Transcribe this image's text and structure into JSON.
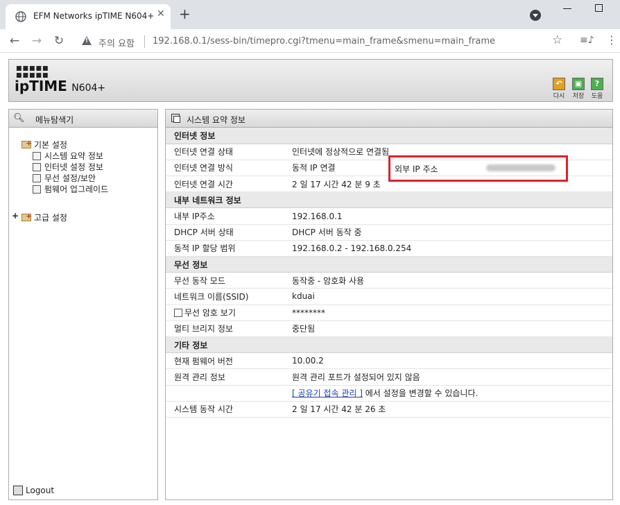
{
  "browser": {
    "tab_title": "EFM Networks ipTIME N604+",
    "tab_close": "✕",
    "new_tab": "+",
    "address_warning": "주의 요함",
    "url": "192.168.0.1/sess-bin/timepro.cgi?tmenu=main_frame&smenu=main_frame",
    "icons": [
      "globe-icon",
      "back-icon",
      "forward-icon",
      "reload-icon",
      "warning-icon",
      "star-icon",
      "media-control-icon",
      "more-menu-icon",
      "minimize-icon",
      "maximize-icon"
    ]
  },
  "router": {
    "brand": "ipTIME",
    "model": "N604+",
    "header_buttons": [
      {
        "label": "다시",
        "color": "#e0a020",
        "icon": "undo-icon"
      },
      {
        "label": "저장",
        "color": "#4caf50",
        "icon": "save-icon"
      },
      {
        "label": "도움",
        "color": "#4caf50",
        "icon": "help-icon"
      }
    ],
    "sidebar": {
      "title": "메뉴탐색기",
      "basic_folder": "기본 설정",
      "basic_items": [
        "시스템 요약 정보",
        "인터넷 설정 정보",
        "무선 설정/보안",
        "펌웨어 업그레이드"
      ],
      "advanced_folder": "고급 설정",
      "expand_symbol": "+",
      "logout": "Logout"
    },
    "content": {
      "title": "시스템 요약 정보",
      "sections": {
        "internet": {
          "title": "인터넷 정보",
          "rows": [
            {
              "label": "인터넷 연결 상태",
              "value": "인터넷에 정상적으로 연결됨"
            },
            {
              "label": "인터넷 연결 방식",
              "value": "동적 IP 연결"
            },
            {
              "label": "인터넷 연결 시간",
              "value": "2 일 17 시간 42 분 9 초"
            }
          ],
          "external_ip_label": "외부 IP 주소"
        },
        "lan": {
          "title": "내부 네트워크 정보",
          "rows": [
            {
              "label": "내부 IP주소",
              "value": "192.168.0.1"
            },
            {
              "label": "DHCP 서버 상태",
              "value": "DHCP 서버 동작 중"
            },
            {
              "label": "동적 IP 할당 범위",
              "value": "192.168.0.2 -  192.168.0.254"
            }
          ]
        },
        "wireless": {
          "title": "무선 정보",
          "rows": [
            {
              "label": "무선 동작 모드",
              "value": "동작중 - 암호화 사용"
            },
            {
              "label": "네트워크 이름(SSID)",
              "value": "kduai"
            },
            {
              "label": "무선 암호 보기",
              "value": "********"
            },
            {
              "label": "멀티 브리지 정보",
              "value": "중단됨"
            }
          ]
        },
        "etc": {
          "title": "기타 정보",
          "rows": [
            {
              "label": "현재 펌웨어 버전",
              "value": "10.00.2"
            },
            {
              "label": "원격 관리 정보",
              "value": "원격 관리 포트가 설정되어 있지 않음"
            }
          ],
          "link_text": "[ 공유기 접속 관리 ]",
          "link_suffix": "에서 설정을 변경할 수 있습니다.",
          "uptime_label": "시스템 동작 시간",
          "uptime_value": "2 일 17 시간 42 분 26 초"
        }
      }
    }
  }
}
